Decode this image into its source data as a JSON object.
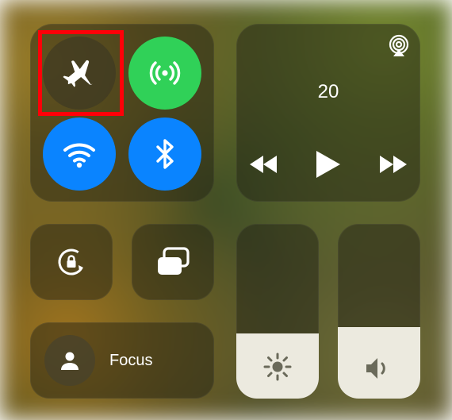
{
  "connectivity": {
    "airplane": {
      "name": "airplane-mode",
      "active": false,
      "highlighted": true
    },
    "cellular": {
      "name": "cellular-data",
      "active": true
    },
    "wifi": {
      "name": "wifi",
      "active": true
    },
    "bluetooth": {
      "name": "bluetooth",
      "active": true
    }
  },
  "media": {
    "title": "20",
    "airplay": "airplay-icon",
    "controls": {
      "prev": "rewind",
      "play": "play",
      "next": "forward"
    }
  },
  "orientation_lock": {
    "locked": false
  },
  "screen_mirroring": {
    "name": "screen-mirroring"
  },
  "focus": {
    "label": "Focus",
    "active": false
  },
  "brightness": {
    "level_pct": 37
  },
  "volume": {
    "level_pct": 41
  },
  "colors": {
    "green": "#30d158",
    "blue": "#0a84ff",
    "highlight": "#ff0008"
  }
}
